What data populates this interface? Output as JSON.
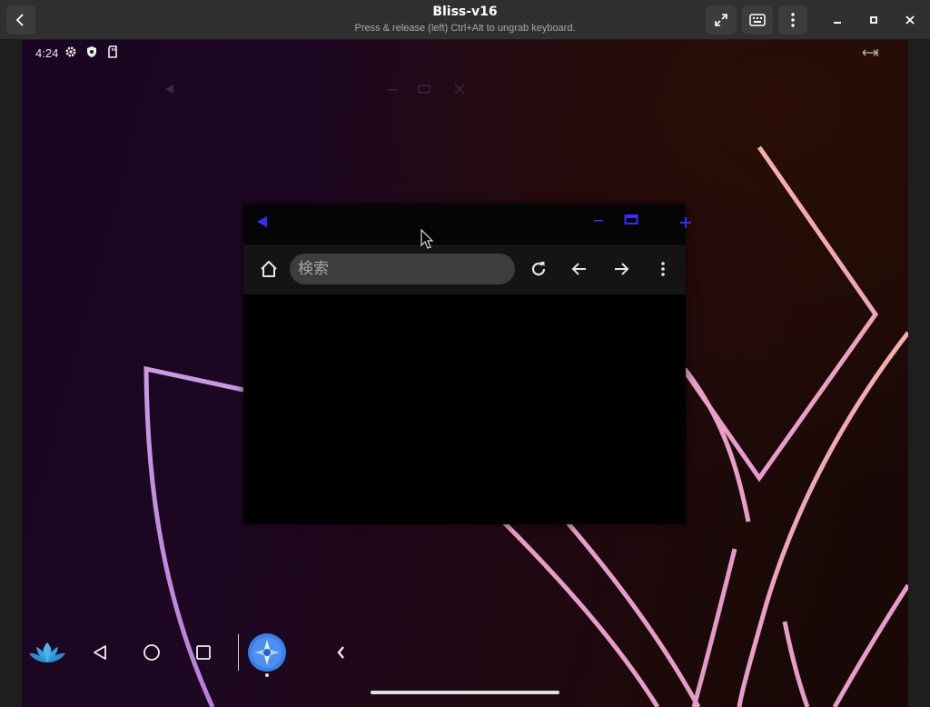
{
  "host": {
    "title": "Bliss-v16",
    "subtitle": "Press & release (left) Ctrl+Alt to ungrab keyboard.",
    "back_icon": "chevron-left-icon",
    "fullscreen_icon": "fullscreen-icon",
    "keyboard_icon": "keyboard-icon",
    "menu_icon": "kebab-menu-icon"
  },
  "statusbar": {
    "time": "4:24",
    "icons": [
      "settings-icon",
      "shield-icon",
      "sd-card-icon"
    ],
    "right_icon": "expand-arrows-icon"
  },
  "browser": {
    "search_placeholder": "検索",
    "title_bar_icons": [
      "back-triangle-icon",
      "minimize-icon",
      "maximize-icon",
      "close-icon"
    ],
    "toolbar_icons": [
      "home-icon",
      "reload-icon",
      "back-arrow-icon",
      "forward-arrow-icon",
      "more-vert-icon"
    ]
  },
  "taskbar": {
    "icons": [
      "lotus-icon",
      "nav-back-icon",
      "nav-home-icon",
      "nav-recents-icon",
      "browser-app-icon",
      "collapse-icon"
    ]
  },
  "colors": {
    "accent_blue": "#3a2cf0",
    "wallpaper_line_pink": "#f0a7c4",
    "wallpaper_line_violet": "#c89be0"
  }
}
